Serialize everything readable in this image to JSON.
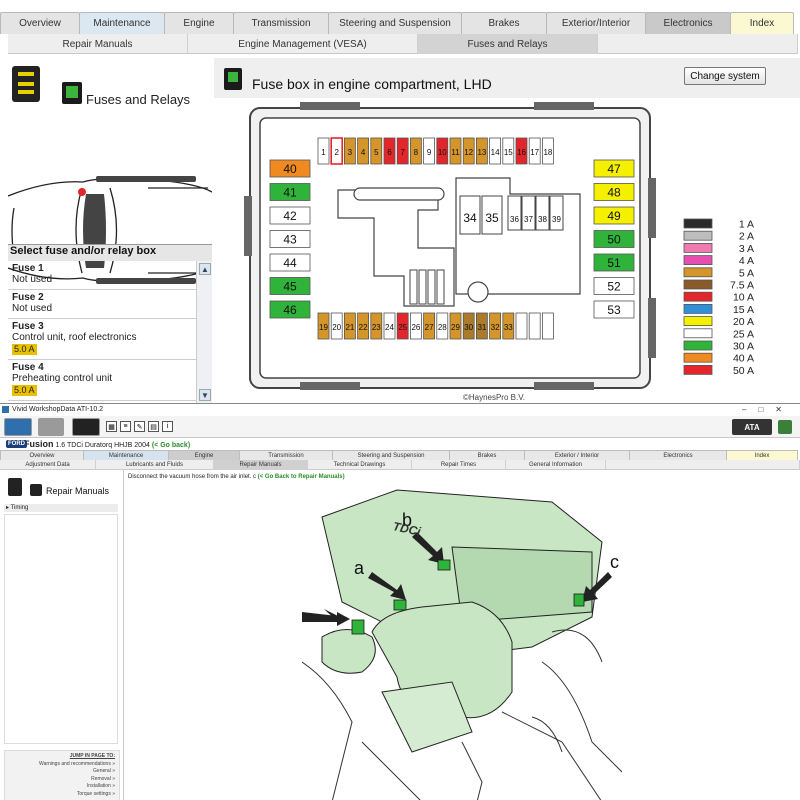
{
  "top": {
    "tabs_main": [
      {
        "label": "Overview",
        "w": 80,
        "style": ""
      },
      {
        "label": "Maintenance",
        "w": 86,
        "style": "active"
      },
      {
        "label": "Engine",
        "w": 70,
        "style": ""
      },
      {
        "label": "Transmission",
        "w": 96,
        "style": ""
      },
      {
        "label": "Steering and Suspension",
        "w": 134,
        "style": ""
      },
      {
        "label": "Brakes",
        "w": 86,
        "style": ""
      },
      {
        "label": "Exterior/Interior",
        "w": 100,
        "style": ""
      },
      {
        "label": "Electronics",
        "w": 86,
        "style": "dark"
      },
      {
        "label": "Index",
        "w": 64,
        "style": "yellow"
      }
    ],
    "tabs_sub": [
      {
        "label": "Repair Manuals",
        "w": 180,
        "style": ""
      },
      {
        "label": "Engine Management (VESA)",
        "w": 230,
        "style": ""
      },
      {
        "label": "Fuses and Relays",
        "w": 180,
        "style": "active"
      },
      {
        "label": "",
        "w": 200,
        "style": ""
      }
    ],
    "left": {
      "title": "Fuses and Relays",
      "select_title": "Select fuse and/or relay box",
      "fuses": [
        {
          "name": "Fuse 1",
          "desc": "Not used",
          "amp": ""
        },
        {
          "name": "Fuse 2",
          "desc": "Not used",
          "amp": ""
        },
        {
          "name": "Fuse 3",
          "desc": "Control unit, roof electronics",
          "amp": "5.0 A"
        },
        {
          "name": "Fuse 4",
          "desc": "Preheating control unit",
          "amp": "5.0 A"
        }
      ]
    },
    "main": {
      "title": "Fuse box in engine compartment, LHD",
      "change_button": "Change system",
      "copyright": "©HaynesPro B.V."
    },
    "fusebox": {
      "top_row": [
        {
          "n": "1",
          "c": "#ffffff"
        },
        {
          "n": "2",
          "c": "#ffffff",
          "hl": true
        },
        {
          "n": "3",
          "c": "#d4952a"
        },
        {
          "n": "4",
          "c": "#d4952a"
        },
        {
          "n": "5",
          "c": "#d4952a"
        },
        {
          "n": "6",
          "c": "#e3262b"
        },
        {
          "n": "7",
          "c": "#e3262b"
        },
        {
          "n": "8",
          "c": "#d4952a"
        },
        {
          "n": "9",
          "c": "#ffffff"
        },
        {
          "n": "10",
          "c": "#e3262b"
        },
        {
          "n": "11",
          "c": "#d4952a"
        },
        {
          "n": "12",
          "c": "#d4952a"
        },
        {
          "n": "13",
          "c": "#d4952a"
        },
        {
          "n": "14",
          "c": "#ffffff"
        },
        {
          "n": "15",
          "c": "#ffffff"
        },
        {
          "n": "16",
          "c": "#e3262b"
        },
        {
          "n": "17",
          "c": "#ffffff"
        },
        {
          "n": "18",
          "c": "#ffffff"
        }
      ],
      "bottom_row": [
        {
          "n": "19",
          "c": "#d4952a"
        },
        {
          "n": "20",
          "c": "#ffffff"
        },
        {
          "n": "21",
          "c": "#d4952a"
        },
        {
          "n": "22",
          "c": "#d4952a"
        },
        {
          "n": "23",
          "c": "#d4952a"
        },
        {
          "n": "24",
          "c": "#ffffff"
        },
        {
          "n": "25",
          "c": "#e3262b"
        },
        {
          "n": "26",
          "c": "#ffffff"
        },
        {
          "n": "27",
          "c": "#d4952a"
        },
        {
          "n": "28",
          "c": "#ffffff"
        },
        {
          "n": "29",
          "c": "#d4952a"
        },
        {
          "n": "30",
          "c": "#ab7a2b"
        },
        {
          "n": "31",
          "c": "#ab7a2b"
        },
        {
          "n": "32",
          "c": "#d4952a"
        },
        {
          "n": "33",
          "c": "#d4952a"
        },
        {
          "n": "",
          "c": "#ffffff"
        },
        {
          "n": "",
          "c": "#ffffff"
        },
        {
          "n": "",
          "c": "#ffffff"
        }
      ],
      "left_col": [
        {
          "n": "40",
          "c": "#f08a20"
        },
        {
          "n": "41",
          "c": "#2fb33a"
        },
        {
          "n": "42",
          "c": "#ffffff"
        },
        {
          "n": "43",
          "c": "#ffffff"
        },
        {
          "n": "44",
          "c": "#ffffff"
        },
        {
          "n": "45",
          "c": "#2fb33a"
        },
        {
          "n": "46",
          "c": "#2fb33a"
        }
      ],
      "right_col": [
        {
          "n": "47",
          "c": "#f4f000"
        },
        {
          "n": "48",
          "c": "#f4f000"
        },
        {
          "n": "49",
          "c": "#f4f000"
        },
        {
          "n": "50",
          "c": "#2fb33a"
        },
        {
          "n": "51",
          "c": "#2fb33a"
        },
        {
          "n": "52",
          "c": "#ffffff"
        },
        {
          "n": "53",
          "c": "#ffffff"
        }
      ],
      "relays_big": [
        "34",
        "35"
      ],
      "relays_small": [
        "36",
        "37",
        "38",
        "39"
      ]
    },
    "legend": [
      {
        "label": "1 A",
        "c": "#2b2b2b"
      },
      {
        "label": "2 A",
        "c": "#bdbdbd"
      },
      {
        "label": "3 A",
        "c": "#ef7ab0"
      },
      {
        "label": "4 A",
        "c": "#e54fb0"
      },
      {
        "label": "5 A",
        "c": "#d4952a"
      },
      {
        "label": "7.5 A",
        "c": "#8a5a2b"
      },
      {
        "label": "10 A",
        "c": "#e3262b"
      },
      {
        "label": "15 A",
        "c": "#2f8fd9"
      },
      {
        "label": "20 A",
        "c": "#f4f000"
      },
      {
        "label": "25 A",
        "c": "#ffffff"
      },
      {
        "label": "30 A",
        "c": "#2fb33a"
      },
      {
        "label": "40 A",
        "c": "#f08a20"
      },
      {
        "label": "50 A",
        "c": "#e3262b"
      }
    ]
  },
  "bottom": {
    "window_title": "Vivid WorkshopData ATI-10.2",
    "window_controls": "–□✕",
    "brand": "FORD",
    "model": "Fusion",
    "engine": "1.6 TDCi Duratorq HHJB 2004",
    "go_back": "(< Go back)",
    "logo": "ATA",
    "tabs_main": [
      {
        "label": "Overview",
        "w": 84,
        "style": ""
      },
      {
        "label": "Maintenance",
        "w": 86,
        "style": "active"
      },
      {
        "label": "Engine",
        "w": 72,
        "style": "dark"
      },
      {
        "label": "Transmission",
        "w": 94,
        "style": ""
      },
      {
        "label": "Steering and Suspension",
        "w": 118,
        "style": ""
      },
      {
        "label": "Brakes",
        "w": 76,
        "style": ""
      },
      {
        "label": "Exterior / Interior",
        "w": 106,
        "style": ""
      },
      {
        "label": "Electronics",
        "w": 98,
        "style": ""
      },
      {
        "label": "Index",
        "w": 72,
        "style": "yellow"
      }
    ],
    "tabs_sub": [
      {
        "label": "Adjustment Data",
        "w": 96,
        "style": ""
      },
      {
        "label": "Lubricants and Fluids",
        "w": 118,
        "style": ""
      },
      {
        "label": "Repair Manuals",
        "w": 94,
        "style": "active"
      },
      {
        "label": "Technical Drawings",
        "w": 104,
        "style": ""
      },
      {
        "label": "Repair Times",
        "w": 94,
        "style": ""
      },
      {
        "label": "General Information",
        "w": 100,
        "style": ""
      },
      {
        "label": "",
        "w": 194,
        "style": ""
      }
    ],
    "left": {
      "title": "Repair Manuals",
      "tree_item": "▸ Timing",
      "jump_title": "JUMP IN PAGE TO:",
      "jump_items": [
        "Warnings and recommendations »",
        "General »",
        "Removal »",
        "Installation »",
        "Torque settings »"
      ]
    },
    "instruction": "Disconnect the vacuum hose from the air inlet. c",
    "instruction_back": "(< Go Back to Repair Manuals)",
    "callouts": [
      "a",
      "b",
      "c"
    ],
    "engine_label": "TDCi"
  }
}
